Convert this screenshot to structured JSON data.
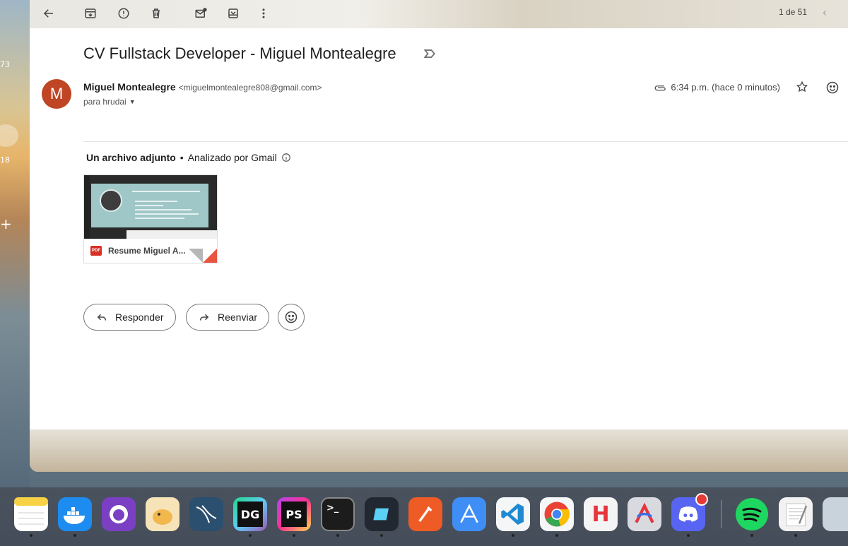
{
  "desktop": {
    "left_numbers": [
      "73",
      "18"
    ],
    "plus_label": "+"
  },
  "toolbar": {
    "page_count": "1 de 51"
  },
  "email": {
    "subject": "CV Fullstack Developer - Miguel Montealegre",
    "avatar_initial": "M",
    "sender_name": "Miguel Montealegre",
    "sender_email": "<miguelmontealegre808@gmail.com>",
    "recipient": "para hrudai",
    "time": "6:34 p.m. (hace 0 minutos)"
  },
  "attachments": {
    "title": "Un archivo adjunto",
    "separator": "•",
    "scanned": "Analizado por Gmail",
    "file_badge": "PDF",
    "file_name": "Resume Miguel A..."
  },
  "actions": {
    "reply_label": "Responder",
    "forward_label": "Reenviar"
  },
  "dock": {
    "apps": [
      {
        "name": "finder",
        "label": "",
        "color": "#2f8fe8"
      },
      {
        "name": "notes",
        "label": "",
        "color": "#f6d244"
      },
      {
        "name": "docker",
        "label": "",
        "color": "#1d8cf0"
      },
      {
        "name": "github-desktop",
        "label": "",
        "color": "#7b3fc4"
      },
      {
        "name": "tableplus",
        "label": "",
        "color": "#f2c14e"
      },
      {
        "name": "mysql-workbench",
        "label": "",
        "color": "#2b4f6e"
      },
      {
        "name": "datagrip",
        "label": "DG",
        "color": "#111111"
      },
      {
        "name": "phpstorm",
        "label": "PS",
        "color": "#111111"
      },
      {
        "name": "terminal",
        "label": ">_",
        "color": "#1c1c1c"
      },
      {
        "name": "warp",
        "label": "",
        "color": "#222831"
      },
      {
        "name": "postman",
        "label": "",
        "color": "#ef5b25"
      },
      {
        "name": "xcode-instruments",
        "label": "",
        "color": "#3f8ef5"
      },
      {
        "name": "vscode",
        "label": "",
        "color": "#f4f6f8"
      },
      {
        "name": "chrome",
        "label": "",
        "color": "#f4f6f8"
      },
      {
        "name": "hostinger",
        "label": "H",
        "color": "#f4f4f4"
      },
      {
        "name": "arc",
        "label": "",
        "color": "#d9d9e0"
      },
      {
        "name": "discord",
        "label": "",
        "color": "#5865f2"
      },
      {
        "name": "spotify",
        "label": "",
        "color": "#1ed760"
      },
      {
        "name": "textedit",
        "label": "",
        "color": "#f2f2f2"
      },
      {
        "name": "preview",
        "label": "",
        "color": "#c9d3dc"
      }
    ]
  }
}
